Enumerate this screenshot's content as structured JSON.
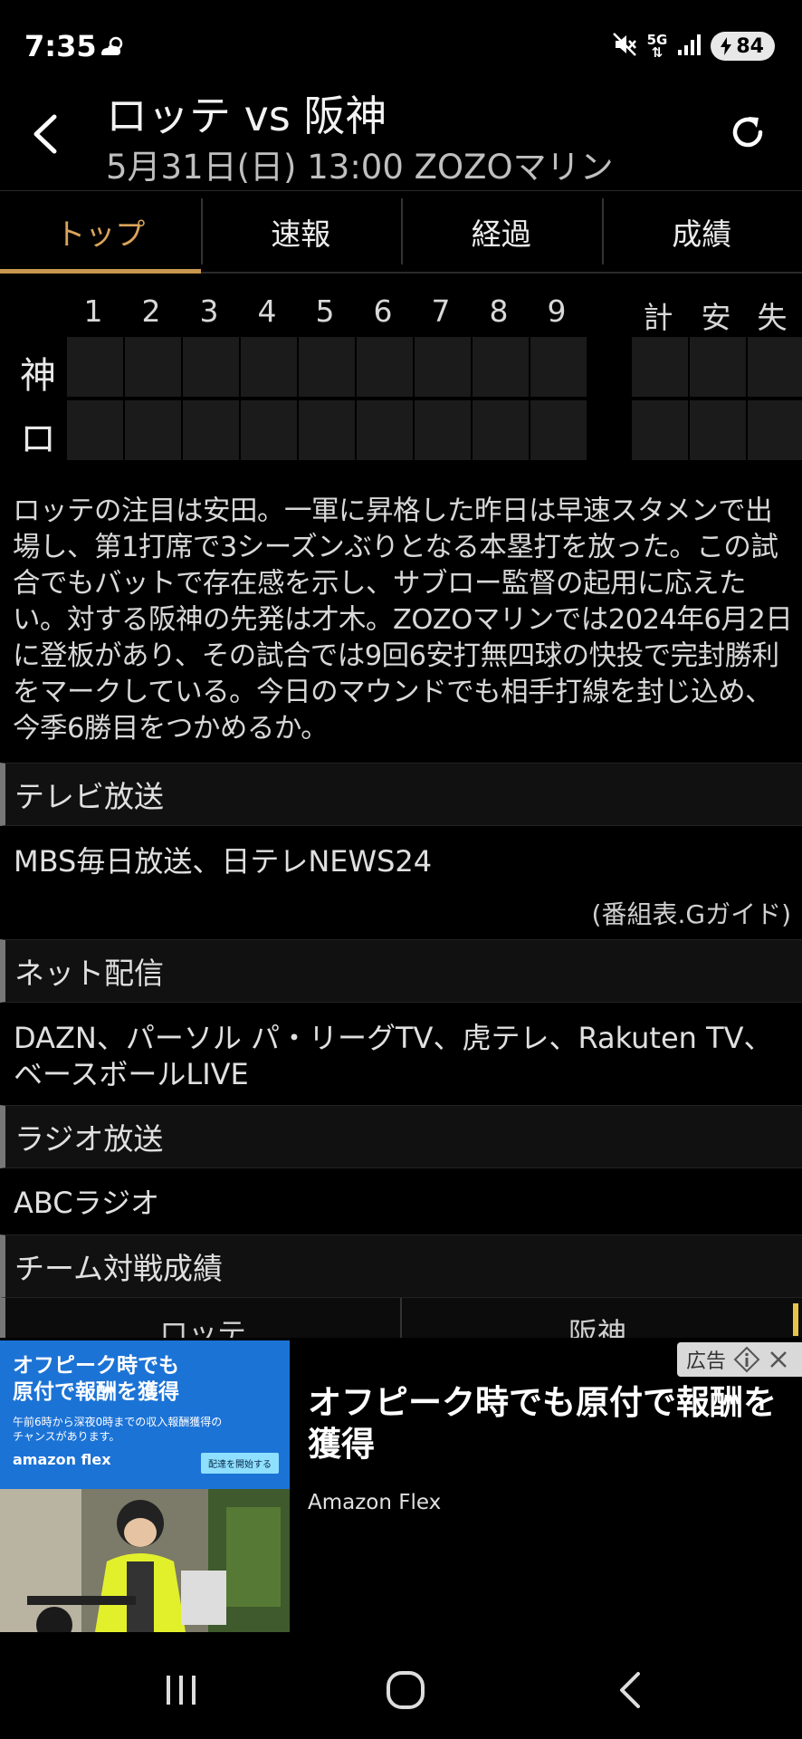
{
  "status_bar": {
    "time": "7:35",
    "network": "5G",
    "battery": "84"
  },
  "header": {
    "title": "ロッテ vs 阪神",
    "subtitle": "5月31日(日) 13:00 ZOZOマリン"
  },
  "tabs": [
    {
      "label": "トップ",
      "active": true
    },
    {
      "label": "速報",
      "active": false
    },
    {
      "label": "経過",
      "active": false
    },
    {
      "label": "成績",
      "active": false
    }
  ],
  "scoreboard": {
    "innings": [
      "1",
      "2",
      "3",
      "4",
      "5",
      "6",
      "7",
      "8",
      "9"
    ],
    "totals": [
      "計",
      "安",
      "失"
    ],
    "teams": [
      "神",
      "ロ"
    ]
  },
  "description": "ロッテの注目は安田。一軍に昇格した昨日は早速スタメンで出場し、第1打席で3シーズンぶりとなる本塁打を放った。この試合でもバットで存在感を示し、サブロー監督の起用に応えたい。対する阪神の先発は才木。ZOZOマリンでは2024年6月2日に登板があり、その試合では9回6安打無四球の快投で完封勝利をマークしている。今日のマウンドでも相手打線を封じ込め、今季6勝目をつかめるか。",
  "tv": {
    "heading": "テレビ放送",
    "channels": "MBS毎日放送、日テレNEWS24",
    "source": "(番組表.Gガイド)"
  },
  "net": {
    "heading": "ネット配信",
    "line1": "DAZN、パーソル パ・リーグTV、虎テレ、Rakuten TV、",
    "line2": "ベースボールLIVE"
  },
  "radio": {
    "heading": "ラジオ放送",
    "stations": "ABCラジオ"
  },
  "head_to_head": {
    "heading": "チーム対戦成績",
    "team1": "ロッテ",
    "team2": "阪神"
  },
  "ad": {
    "badge": "広告",
    "image_heading_1": "オフピーク時でも",
    "image_heading_2": "原付で報酬を獲得",
    "image_small_1": "午前6時から深夜0時までの収入報酬獲得の",
    "image_small_2": "チャンスがあります。",
    "image_logo": "amazon flex",
    "image_button": "配達を開始する",
    "title": "オフピーク時でも原付で報酬を獲得",
    "advertiser": "Amazon Flex"
  },
  "colors": {
    "accent": "#d9a55a",
    "background": "#000000",
    "score_cell": "#1b1b1b"
  }
}
